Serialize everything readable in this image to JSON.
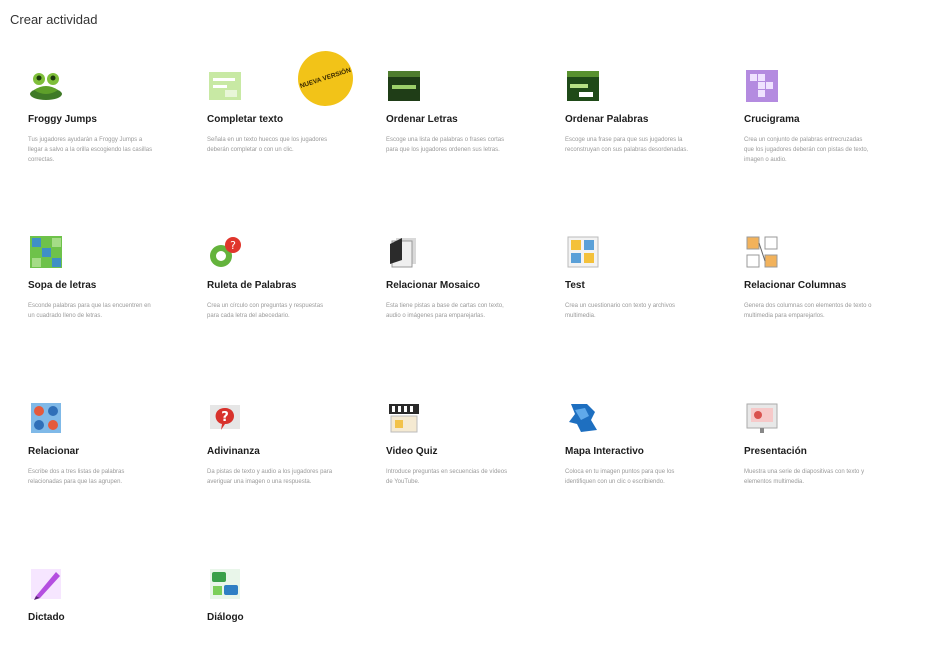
{
  "page_title": "Crear actividad",
  "badge_text": "NUEVA VERSIÓN",
  "activities": [
    {
      "title": "Froggy Jumps",
      "desc": "Tus jugadores ayudarán a Froggy Jumps a llegar a salvo a la orilla escogiendo las casillas correctas.",
      "icon": "frog-icon"
    },
    {
      "title": "Completar texto",
      "desc": "Señala en un texto huecos que los jugadores deberán completar o con un clic.",
      "icon": "fill-text-icon"
    },
    {
      "title": "Ordenar Letras",
      "desc": "Escoge una lista de palabras o frases cortas para que los jugadores ordenen sus letras.",
      "icon": "sort-letters-icon"
    },
    {
      "title": "Ordenar Palabras",
      "desc": "Escoge una frase para que sus jugadores la reconstruyan con sus palabras desordenadas.",
      "icon": "sort-words-icon"
    },
    {
      "title": "Crucigrama",
      "desc": "Crea un conjunto de palabras entrecruzadas que los jugadores deberán con pistas de texto, imagen o audio.",
      "icon": "crossword-icon"
    },
    {
      "title": "Sopa de letras",
      "desc": "Esconde palabras para que las encuentren en un cuadrado lleno de letras.",
      "icon": "word-search-icon"
    },
    {
      "title": "Ruleta de Palabras",
      "desc": "Crea un círculo con preguntas y respuestas para cada letra del abecedario.",
      "icon": "word-wheel-icon"
    },
    {
      "title": "Relacionar Mosaico",
      "desc": "Esta tiene pistas a base de cartas con texto, audio o imágenes para emparejarlas.",
      "icon": "mosaic-icon"
    },
    {
      "title": "Test",
      "desc": "Crea un cuestionario con texto y archivos multimedia.",
      "icon": "test-icon"
    },
    {
      "title": "Relacionar Columnas",
      "desc": "Genera dos columnas con elementos de texto o multimedia para emparejarlos.",
      "icon": "columns-icon"
    },
    {
      "title": "Relacionar",
      "desc": "Escribe dos a tres listas de palabras relacionadas para que las agrupen.",
      "icon": "relate-icon"
    },
    {
      "title": "Adivinanza",
      "desc": "Da pistas de texto y audio a los jugadores para averiguar una imagen o una respuesta.",
      "icon": "riddle-icon"
    },
    {
      "title": "Video Quiz",
      "desc": "Introduce preguntas en secuencias de vídeos de YouTube.",
      "icon": "video-quiz-icon"
    },
    {
      "title": "Mapa Interactivo",
      "desc": "Coloca en tu imagen puntos para que los identifiquen con un clic o escribiendo.",
      "icon": "map-icon"
    },
    {
      "title": "Presentación",
      "desc": "Muestra una serie de diapositivas con texto y elementos multimedia.",
      "icon": "presentation-icon"
    },
    {
      "title": "Dictado",
      "desc": "",
      "icon": "dictation-icon"
    },
    {
      "title": "Diálogo",
      "desc": "",
      "icon": "dialogue-icon"
    }
  ]
}
